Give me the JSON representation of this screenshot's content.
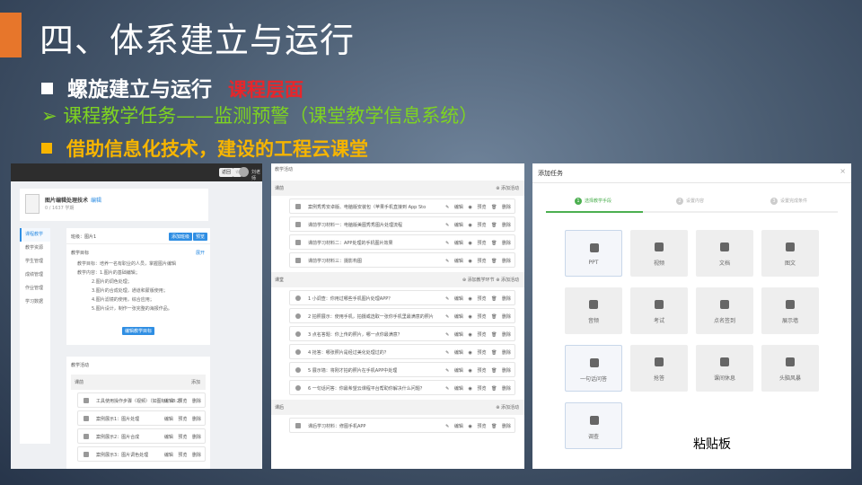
{
  "slide": {
    "title": "四、体系建立与运行",
    "bullet1": "螺旋建立与运行",
    "bullet1_red": "课程层面",
    "bullet2": "➢ 课程教学任务——监测预警（课堂教学信息系统）",
    "bullet3": "借助信息化技术，建设的工程云课堂",
    "clipboard": "粘贴板"
  },
  "s1": {
    "topbar": {
      "btn1": "返回",
      "btn2": "☆",
      "user": "刘老师"
    },
    "course": {
      "title": "图片编辑处理技术",
      "link": "编辑",
      "sub": "0 / 1637 学期"
    },
    "sidebar": [
      "课程教学",
      "教学资源",
      "学生管理",
      "成绩管理",
      "作业管理",
      "学习数据"
    ],
    "card1": {
      "header": "班级：图片1",
      "btn1": "添加班级",
      "btn2": "预览",
      "label": "教学目标",
      "more": "展开",
      "lines": [
        "教学目标：培养一名有职业的人员，掌握图片编辑",
        "教学内容：1.图片的基础编辑；",
        "2.图片的调色处理；",
        "3.图片的合成处理，通道和蒙版使用；",
        "4.图片滤镜的使用，综合应用；",
        "5.图片设计，制作一张完整的海报作品。"
      ],
      "action": "编辑教学目标"
    },
    "card2": {
      "label": "教学活动",
      "section": "课前",
      "section_action": "添加",
      "items": [
        "工具使用操作步骤（视频）（如图标）（8:2）",
        "案例展示1：图片处理",
        "案例展示2：图片合成",
        "案例展示3：图片调色处理"
      ],
      "ops": "编辑 预览 删除"
    }
  },
  "s2": {
    "header": "教学活动",
    "sections": [
      {
        "name": "课前",
        "action": "⊕ 添加活动",
        "items": [
          "案例秀秀安卓版、电脑版安装包（苹果手机直接到 App Sto",
          "课前学习材料一：电脑版美图秀秀图片处理流程",
          "课前学习材料二：APP处理的手机图片效果",
          "课前学习材料三：摄影构图"
        ]
      },
      {
        "name": "课堂",
        "action": "⊕ 添加教学环节  ⊕ 添加活动",
        "items": [
          "1 小调查：你用过哪些手机图片处理APP？",
          "2 拍照展示：使用手机，拍摄或选取一张你手机里最满意的照片",
          "3 点名答题：你上传的照片，哪一点你最满意？",
          "4 抢答：哪张照片是经过美化处理过的？",
          "5 展示墙：将刚才拍的照片在手机APP中处理",
          "6 一句话问答：你最希望云课程平台帮助你解决什么问题？"
        ]
      },
      {
        "name": "课后",
        "action": "⊕ 添加活动",
        "items": [
          "课后学习材料：修图手机APP"
        ]
      }
    ],
    "ops": {
      "edit": "✎ 编辑",
      "preview": "◉ 预览",
      "delete": "🗑 删除"
    }
  },
  "s3": {
    "title": "添加任务",
    "close": "×",
    "steps": [
      {
        "n": "1",
        "label": "选择教学手段"
      },
      {
        "n": "2",
        "label": "设置内容"
      },
      {
        "n": "3",
        "label": "设置完成条件"
      }
    ],
    "tiles": [
      "PPT",
      "视频",
      "文档",
      "图文",
      "音频",
      "考试",
      "点名签到",
      "展示墙",
      "一句话问答",
      "抢答",
      "课间休息",
      "头脑风暴",
      "调查"
    ]
  }
}
